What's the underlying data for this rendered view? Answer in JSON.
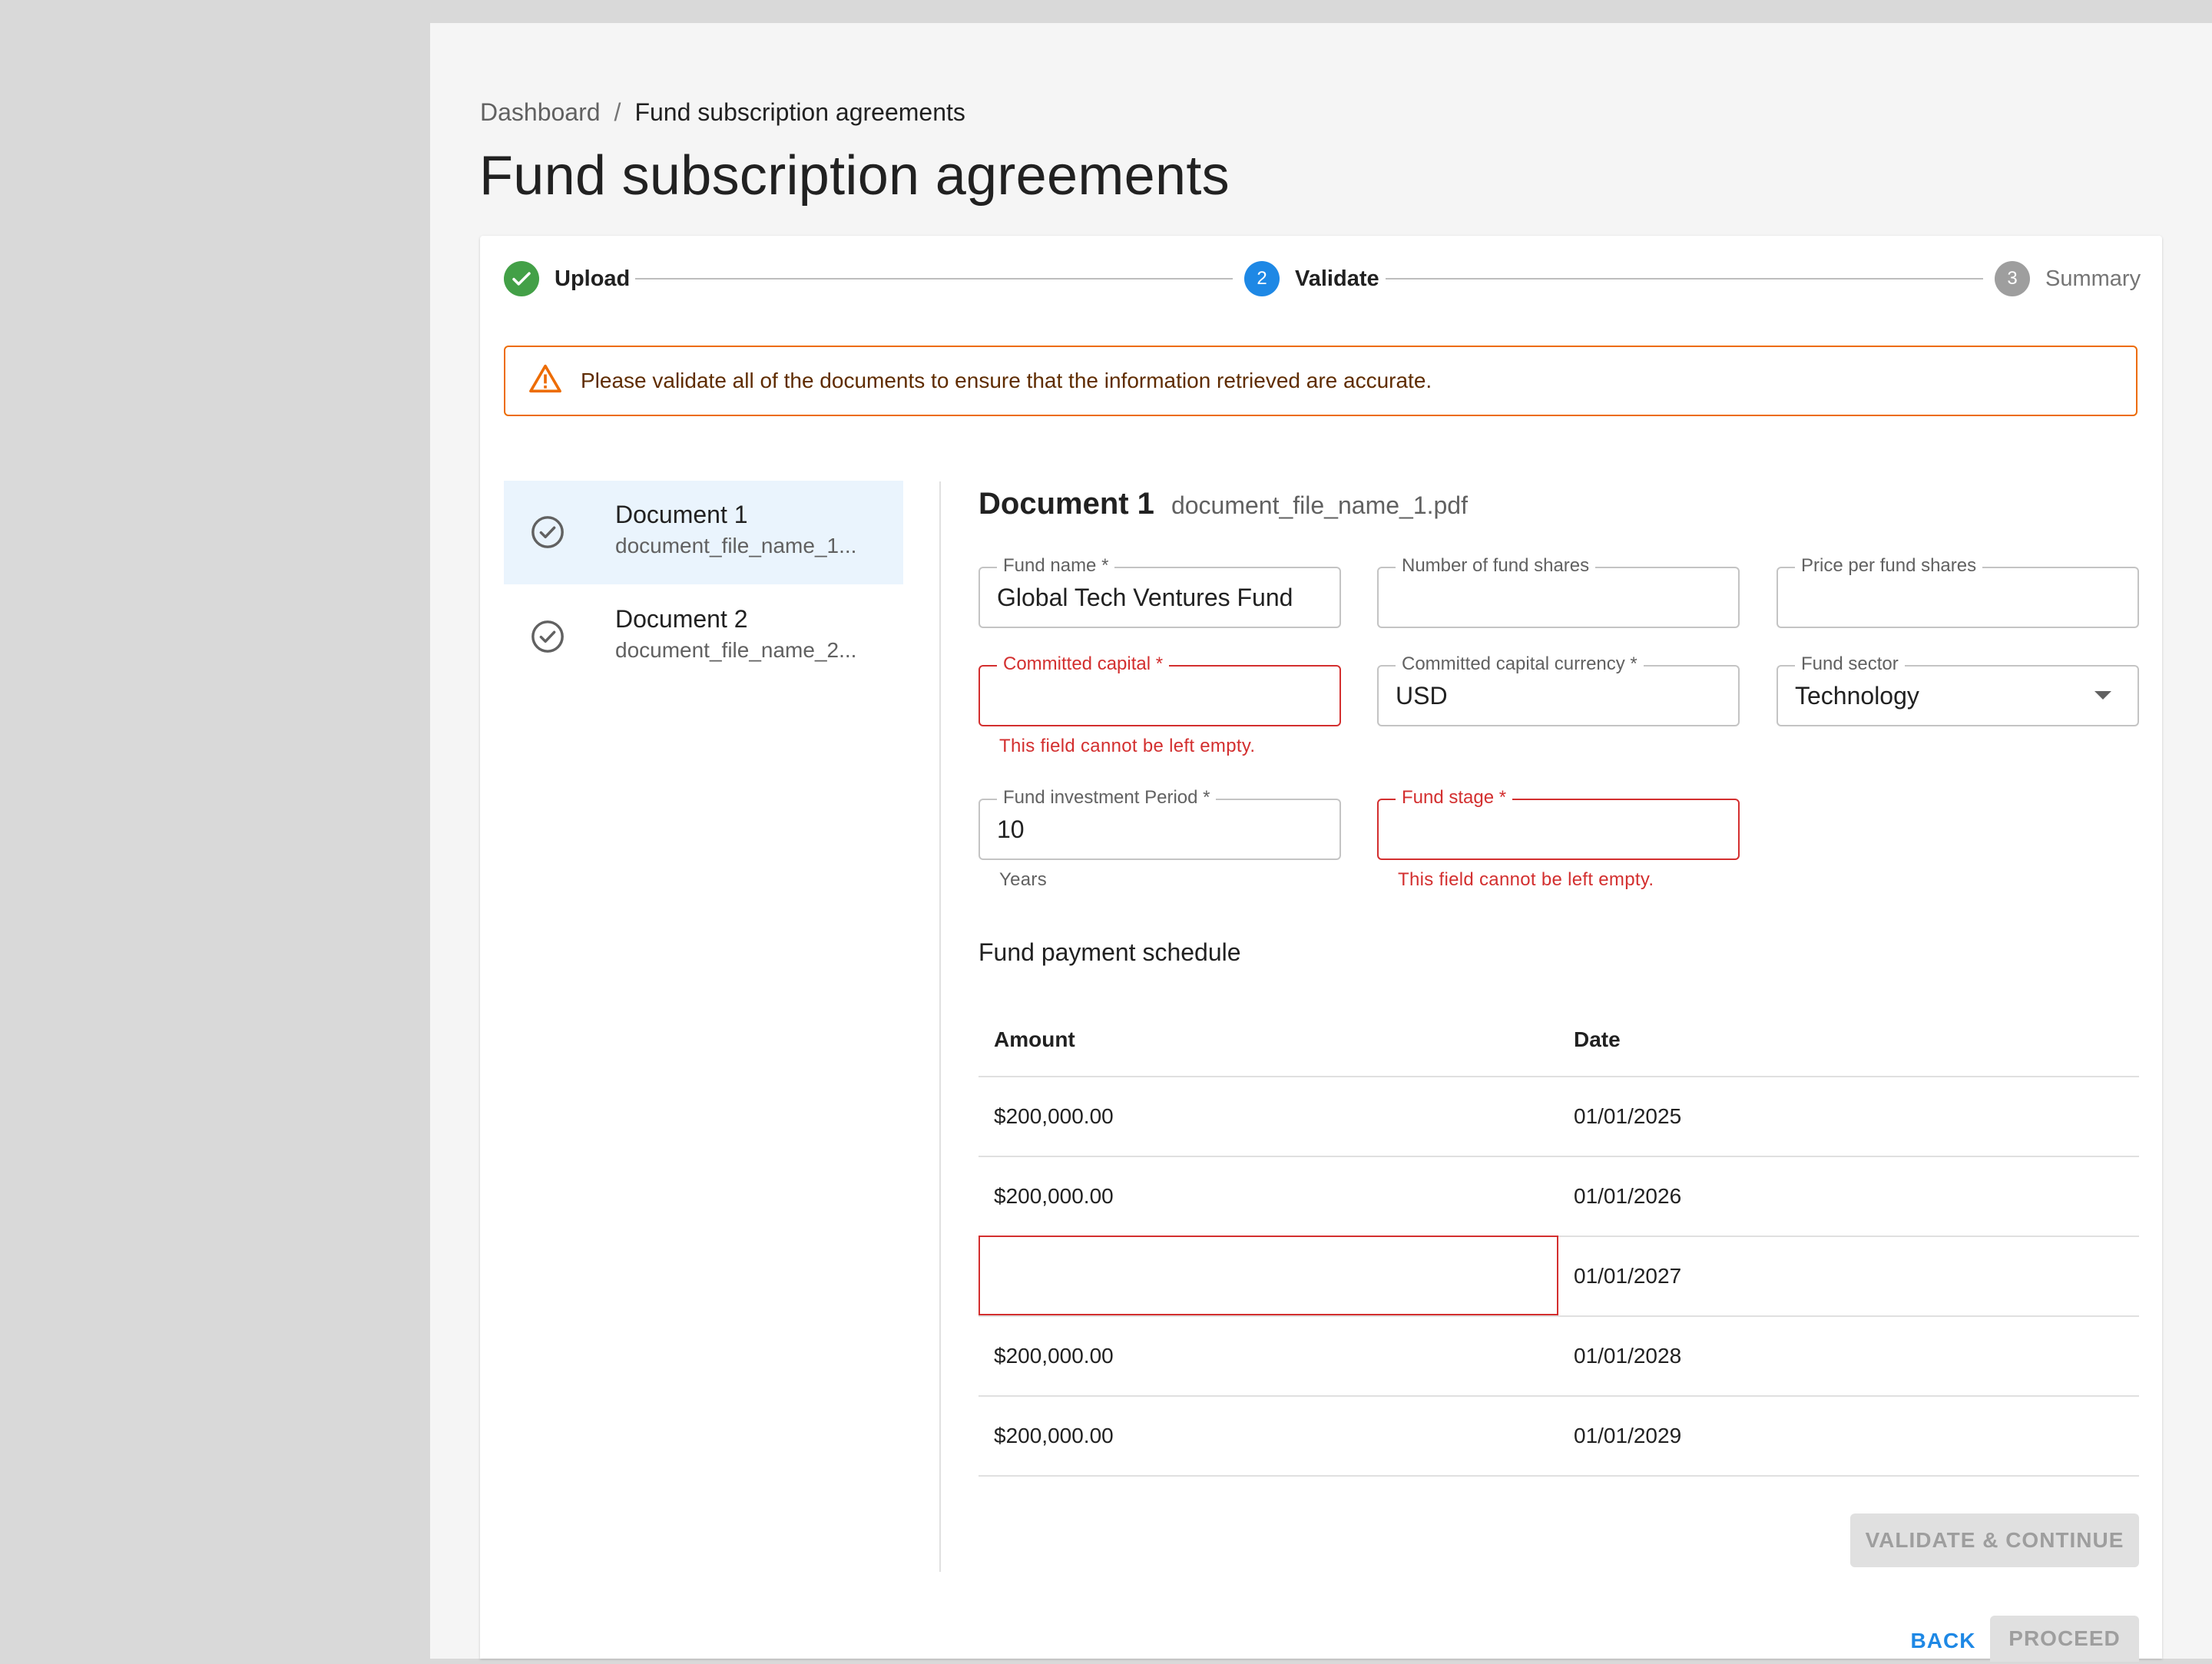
{
  "breadcrumb": {
    "root": "Dashboard",
    "separator": "/",
    "current": "Fund subscription agreements"
  },
  "page_title": "Fund subscription agreements",
  "stepper": {
    "steps": [
      {
        "number": "1",
        "label": "Upload",
        "state": "done"
      },
      {
        "number": "2",
        "label": "Validate",
        "state": "active"
      },
      {
        "number": "3",
        "label": "Summary",
        "state": "pending"
      }
    ]
  },
  "alert": {
    "message": "Please validate all of the documents to ensure that the information retrieved are accurate.",
    "color": "#ed6c02"
  },
  "documents": [
    {
      "title": "Document 1",
      "file": "document_file_name_1...",
      "selected": true
    },
    {
      "title": "Document 2",
      "file": "document_file_name_2...",
      "selected": false
    }
  ],
  "detail": {
    "title": "Document 1",
    "file": "document_file_name_1.pdf",
    "fields": {
      "fund_name": {
        "label": "Fund name *",
        "value": "Global Tech Ventures Fund"
      },
      "num_shares": {
        "label": "Number of fund shares",
        "value": ""
      },
      "price_per_share": {
        "label": "Price per fund shares",
        "value": ""
      },
      "committed_capital": {
        "label": "Committed capital *",
        "value": "",
        "error": "This field cannot be left empty."
      },
      "capital_currency": {
        "label": "Committed capital currency *",
        "value": "USD"
      },
      "fund_sector": {
        "label": "Fund sector",
        "value": "Technology"
      },
      "investment_period": {
        "label": "Fund investment Period *",
        "value": "10",
        "helper": "Years"
      },
      "fund_stage": {
        "label": "Fund stage *",
        "value": "",
        "error": "This field cannot be left empty."
      }
    },
    "schedule": {
      "title": "Fund payment schedule",
      "columns": [
        "Amount",
        "Date"
      ],
      "rows": [
        {
          "amount": "$200,000.00",
          "date": "01/01/2025"
        },
        {
          "amount": "$200,000.00",
          "date": "01/01/2026"
        },
        {
          "amount": "",
          "date": "01/01/2027"
        },
        {
          "amount": "$200,000.00",
          "date": "01/01/2028"
        },
        {
          "amount": "$200,000.00",
          "date": "01/01/2029"
        }
      ]
    },
    "validate_button": "VALIDATE & CONTINUE"
  },
  "footer": {
    "back": "BACK",
    "proceed": "PROCEED"
  },
  "colors": {
    "success": "#43a047",
    "primary": "#1e88e5",
    "error": "#d32f2f",
    "warning": "#ed6c02"
  }
}
